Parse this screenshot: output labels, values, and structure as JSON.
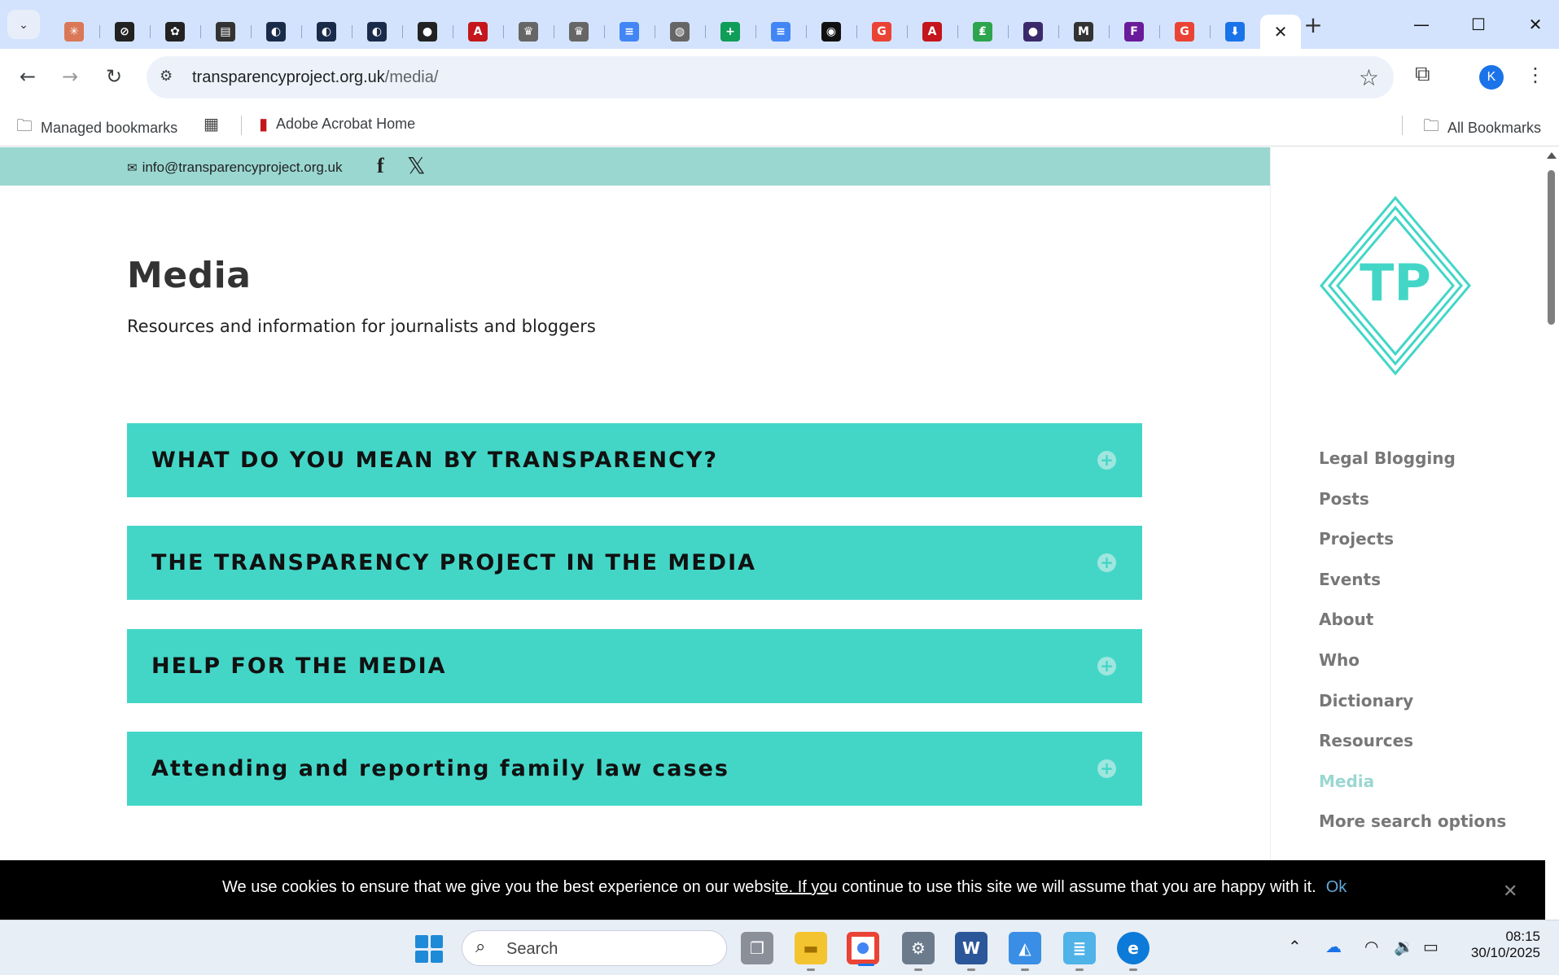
{
  "browser": {
    "tabs": [
      {
        "icon": "claude-icon",
        "color": "#d97757",
        "glyph": "✳"
      },
      {
        "icon": "perplexity-icon",
        "color": "#222222",
        "glyph": "⊘"
      },
      {
        "icon": "chatgpt-icon",
        "color": "#222222",
        "glyph": "✿"
      },
      {
        "icon": "table-icon",
        "color": "#333333",
        "glyph": "▤"
      },
      {
        "icon": "site-icon",
        "color": "#1a2b4a",
        "glyph": "◐"
      },
      {
        "icon": "site-icon",
        "color": "#1a2b4a",
        "glyph": "◐"
      },
      {
        "icon": "site-icon",
        "color": "#1a2b4a",
        "glyph": "◐"
      },
      {
        "icon": "github-icon",
        "color": "#222222",
        "glyph": "●"
      },
      {
        "icon": "acrobat-icon",
        "color": "#c4161c",
        "glyph": "A"
      },
      {
        "icon": "crest-icon",
        "color": "#666666",
        "glyph": "♛"
      },
      {
        "icon": "crest-icon",
        "color": "#666666",
        "glyph": "♛"
      },
      {
        "icon": "docs-icon",
        "color": "#4285f4",
        "glyph": "≡"
      },
      {
        "icon": "globe-icon",
        "color": "#666666",
        "glyph": "◍"
      },
      {
        "icon": "sheets-icon",
        "color": "#0f9d58",
        "glyph": "+"
      },
      {
        "icon": "docs-icon",
        "color": "#4285f4",
        "glyph": "≡"
      },
      {
        "icon": "podcast-icon",
        "color": "#111111",
        "glyph": "◉"
      },
      {
        "icon": "google-icon",
        "color": "#ea4335",
        "glyph": "G"
      },
      {
        "icon": "acrobat-icon",
        "color": "#c4161c",
        "glyph": "A"
      },
      {
        "icon": "green-icon",
        "color": "#2da44e",
        "glyph": "₤"
      },
      {
        "icon": "avatar-icon",
        "color": "#3b2a6b",
        "glyph": "●"
      },
      {
        "icon": "m-icon",
        "color": "#333333",
        "glyph": "M"
      },
      {
        "icon": "f-icon",
        "color": "#6a1b9a",
        "glyph": "F"
      },
      {
        "icon": "google-icon",
        "color": "#ea4335",
        "glyph": "G"
      },
      {
        "icon": "download-icon",
        "color": "#1a73e8",
        "glyph": "⬇"
      }
    ],
    "url_host": "transparencyproject.org.uk",
    "url_path": "/media/",
    "profile_initial": "K"
  },
  "bookmarks": {
    "managed": "Managed bookmarks",
    "acrobat": "Adobe Acrobat Home",
    "all": "All Bookmarks"
  },
  "site": {
    "email": "info@transparencyproject.org.uk",
    "title": "Media",
    "subtitle": "Resources and information for journalists and bloggers",
    "logo_text": "TP",
    "accordion": [
      "WHAT DO YOU MEAN BY TRANSPARENCY?",
      "THE TRANSPARENCY PROJECT IN THE MEDIA",
      "HELP FOR THE MEDIA",
      "Attending and reporting family law cases"
    ],
    "nav": [
      "Legal Blogging",
      "Posts",
      "Projects",
      "Events",
      "About",
      "Who",
      "Dictionary",
      "Resources",
      "Media",
      "More search options"
    ],
    "active_nav": "Media",
    "accent_color": "#43d6c7"
  },
  "cookie": {
    "message_before": "We use cookies to ensure that we give you the best experience on our websi",
    "message_underlined": "te. If yo",
    "message_after": "u continue to use this site we will assume that you are happy with it.",
    "ok": "Ok"
  },
  "taskbar": {
    "search_placeholder": "Search",
    "time": "08:15",
    "date": "30/10/2025"
  }
}
